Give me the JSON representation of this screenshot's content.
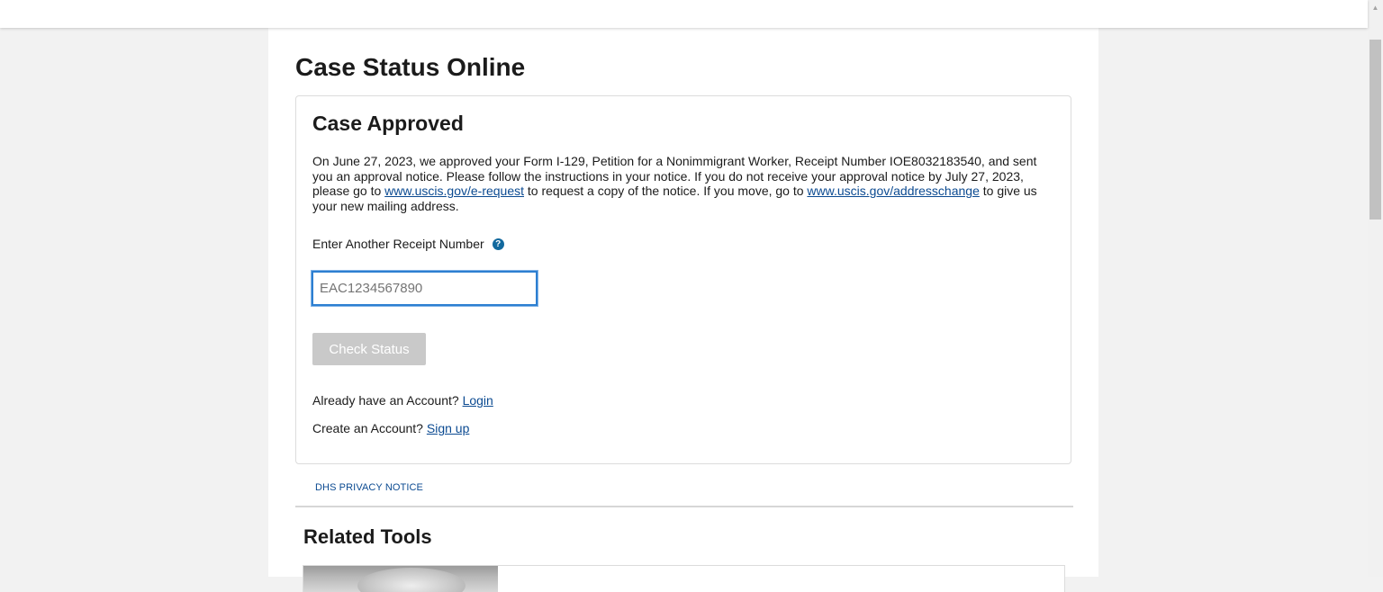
{
  "page_title": "Case Status Online",
  "case": {
    "title": "Case Approved",
    "desc_part1": "On June 27, 2023, we approved your Form I-129, Petition for a Nonimmigrant Worker, Receipt Number IOE8032183540, and sent you an approval notice. Please follow the instructions in your notice. If you do not receive your approval notice by July 27, 2023, please go to ",
    "link_erequest": "www.uscis.gov/e-request",
    "desc_part2": " to request a copy of the notice. If you move, go to ",
    "link_addresschange": "www.uscis.gov/addresschange",
    "desc_part3": " to give us your new mailing address."
  },
  "receipt": {
    "label": "Enter Another Receipt Number",
    "help_icon": "question-circle-icon",
    "help_glyph": "?",
    "placeholder": "EAC1234567890",
    "value": ""
  },
  "check_status_label": "Check Status",
  "account": {
    "login_prompt": "Already have an Account? ",
    "login_link": "Login",
    "signup_prompt": "Create an Account? ",
    "signup_link": "Sign up"
  },
  "privacy_notice": "DHS PRIVACY NOTICE",
  "related_tools_title": "Related Tools",
  "colors": {
    "link": "#0b4a91",
    "help_icon": "#12699e",
    "input_focus_border": "#2d7fd1",
    "disabled_button": "#c9c9c9",
    "page_background": "#f2f2f2"
  }
}
